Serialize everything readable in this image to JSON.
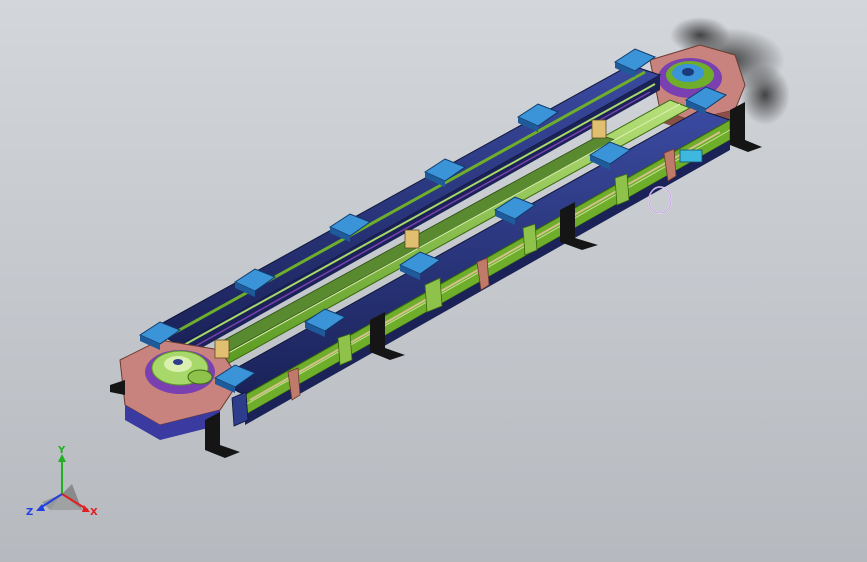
{
  "viewport": {
    "background_top": "#d3d6da",
    "background_bottom": "#b6babf"
  },
  "model": {
    "description_icon": "chain-conveyor-assembly",
    "colors": {
      "frame_dark": "#1f2a66",
      "frame_mid": "#2d3d8c",
      "rail_green": "#6fae2a",
      "rail_light": "#a8d86a",
      "carrier_blue": "#3b93d8",
      "carrier_light": "#7cc0ef",
      "sprocket_pink": "#c9837f",
      "sprocket_purple": "#7a3fb0",
      "leg_black": "#151515",
      "bracket_salmon": "#c07a6a"
    }
  },
  "triad": {
    "x_label": "X",
    "y_label": "Y",
    "z_label": "Z",
    "x_color": "#e02020",
    "y_color": "#20b020",
    "z_color": "#2040e0"
  }
}
